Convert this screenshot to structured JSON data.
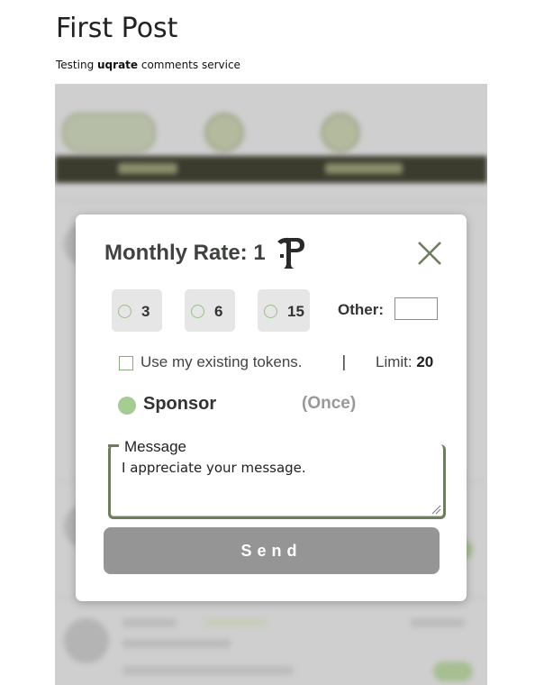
{
  "post": {
    "title": "First Post",
    "subtitle_prefix": "Testing ",
    "subtitle_brand": "uqrate",
    "subtitle_suffix": " comments service"
  },
  "modal": {
    "title": "Monthly Rate: 1",
    "rate_icon": "ticket-glyph-icon",
    "close_icon": "close-icon",
    "rate_options": [
      {
        "label": "3",
        "selected": false
      },
      {
        "label": "6",
        "selected": false
      },
      {
        "label": "15",
        "selected": false
      }
    ],
    "other_label": "Other:",
    "other_value": "",
    "tokens_label": "Use my existing tokens.",
    "tokens_checked": false,
    "separator": "|",
    "limit_label": "Limit: ",
    "limit_value": "20",
    "sponsor_label": "Sponsor",
    "sponsor_note": "(Once)",
    "sponsor_selected": true,
    "message_legend": "Message",
    "message_value": "I appreciate your message.",
    "send_label": "Send"
  },
  "colors": {
    "accent_green": "#a5cc92",
    "border_green": "#6e7d5e",
    "button_gray": "#959595"
  }
}
